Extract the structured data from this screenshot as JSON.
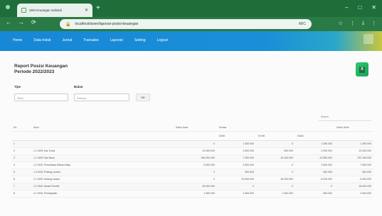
{
  "browser": {
    "tab_title": "SIM Keuangan Subsidi",
    "tab_close": "✕",
    "new_tab": "+",
    "url": "localhost/sisen/laporan-posisi-keuangan",
    "window_buttons": [
      "–",
      "□",
      "✕"
    ],
    "nav_icons": [
      "←",
      "→",
      "⟳"
    ],
    "tool_icons": [
      "☆",
      "⋮",
      "⤓",
      "⋮"
    ],
    "ext_label": "ABC"
  },
  "nav": {
    "items": [
      "Home",
      "Data Induk",
      "Jurnal",
      "Transaksi",
      "Laporan",
      "Setting",
      "Logout"
    ]
  },
  "page": {
    "title_line1": "Report Posisi Keuangan",
    "title_line2": "Periode 2022/2023",
    "export_label": "X"
  },
  "filters": {
    "jenis_label": "Tipe",
    "jenis_value": "Rinci",
    "bulan_label": "Bulan",
    "bulan_value": "Semua",
    "submit_label": "OK"
  },
  "table": {
    "search_placeholder": "Search",
    "headers_top": [
      "No",
      "Akun",
      "Saldo Awal",
      "Mutasi",
      "",
      "",
      "Saldo Akhir"
    ],
    "headers_sub": [
      "",
      "",
      "",
      "Debit",
      "Kredit",
      "Saldo",
      ""
    ],
    "rows": [
      [
        "1",
        "",
        "0",
        "1.250.000",
        "0",
        "1.250.000",
        "1.250.000"
      ],
      [
        "2",
        "1.1.0001 Kas Tunai",
        "10.000.000",
        "2.500.000",
        "500.000",
        "2.000.000",
        "12.000.000"
      ],
      [
        "3",
        "1.1.0002 Kas Bank",
        "250.000.000",
        "7.250.000",
        "20.100.000",
        "-12.850.000",
        "237.150.000"
      ],
      [
        "4",
        "1.2.0001 Persediaan Bahan Baku",
        "5.000.000",
        "2.500.000",
        "0",
        "2.500.000",
        "7.500.000"
      ],
      [
        "5",
        "1.3.0001 Piutang Usaha",
        "0",
        "500.000",
        "0",
        "500.000",
        "500.000"
      ],
      [
        "6",
        "2.1.0001 Hutang Usaha",
        "0",
        "20.000.000",
        "25.000.000",
        "-5.000.000",
        "-5.000.000"
      ],
      [
        "7",
        "2.2.0001 Modal Pemilik",
        "30.000.000",
        "0",
        "0",
        "0",
        "30.000.000"
      ],
      [
        "8",
        "4.1.0001 Pendapatan",
        "1.500.000",
        "1.500.000",
        "1.000.000",
        "500.000",
        "2.000.000"
      ]
    ]
  }
}
